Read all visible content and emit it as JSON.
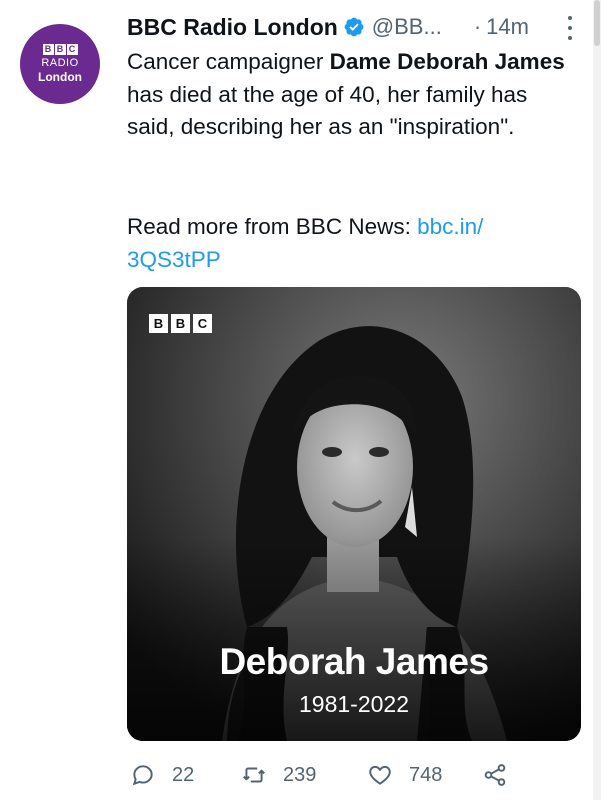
{
  "account": {
    "name": "BBC Radio London",
    "handle": "@BB...",
    "separator": "·",
    "time": "14m",
    "avatar_bbc_letters": [
      "B",
      "B",
      "C"
    ],
    "avatar_line1": "RADIO",
    "avatar_line2": "London",
    "avatar_color": "#6b2a8f",
    "verified_color": "#1d9bf0"
  },
  "tweet": {
    "text_prefix": "Cancer campaigner ",
    "text_bold": "Dame Deborah James",
    "text_suffix": " has died at the age of 40, her family has said, describing her as an \"inspiration\".",
    "read_more_prefix": "Read more from BBC News: ",
    "link_text": "bbc.in/ 3QS3tPP",
    "link_color": "#1d9bf0"
  },
  "media": {
    "logo_letters": [
      "B",
      "B",
      "C"
    ],
    "name": "Deborah James",
    "years": "1981-2022"
  },
  "actions": {
    "replies": "22",
    "retweets": "239",
    "likes": "748"
  },
  "icons": {
    "verified": "verified-badge-icon",
    "more": "vertical-dots-icon",
    "reply": "speech-bubble-icon",
    "retweet": "retweet-arrows-icon",
    "like": "heart-icon",
    "share": "share-nodes-icon"
  }
}
